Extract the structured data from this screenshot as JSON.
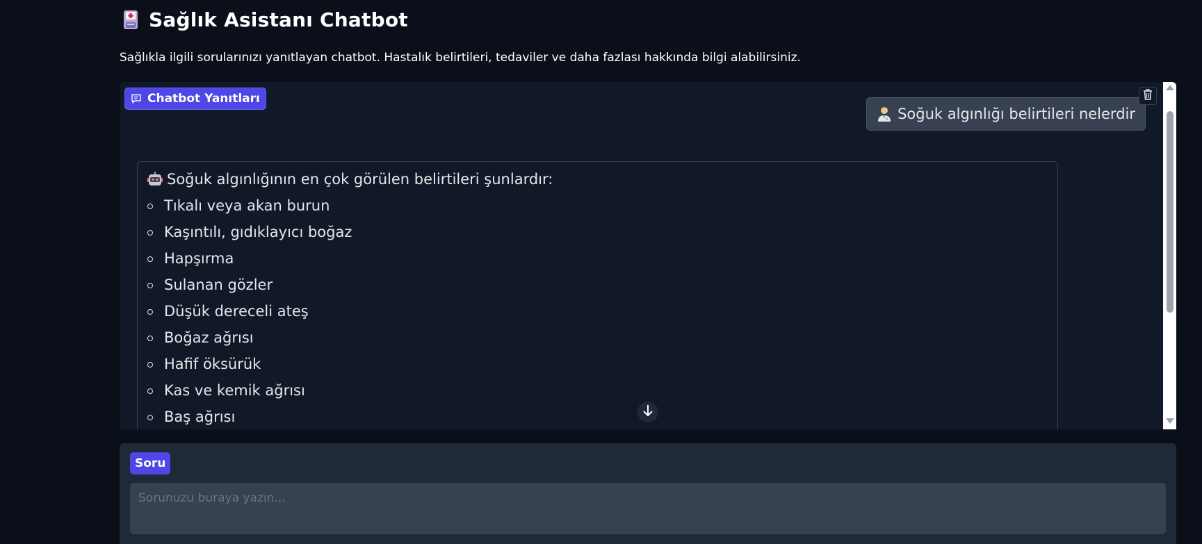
{
  "header": {
    "title": "Sağlık Asistanı Chatbot",
    "title_icon": "medical-disk-icon",
    "subtitle": "Sağlıkla ilgili sorularınızı yanıtlayan chatbot. Hastalık belirtileri, tedaviler ve daha fazlası hakkında bilgi alabilirsiniz."
  },
  "chat": {
    "label": "Chatbot Yanıtları",
    "label_icon": "chat-bubble-icon",
    "clear_icon": "trash-icon",
    "user_message": {
      "avatar": "doctor-icon",
      "text": "Soğuk algınlığı belirtileri nelerdir"
    },
    "bot_message": {
      "avatar": "robot-icon",
      "intro": "Soğuk algınlığının en çok görülen belirtileri şunlardır:",
      "items": [
        "Tıkalı veya akan burun",
        "Kaşıntılı, gıdıklayıcı boğaz",
        "Hapşırma",
        "Sulanan gözler",
        "Düşük dereceli ateş",
        "Boğaz ağrısı",
        "Hafif öksürük",
        "Kas ve kemik ağrısı",
        "Baş ağrısı"
      ]
    },
    "scroll_down_icon": "arrow-down-icon"
  },
  "input": {
    "label": "Soru",
    "value": "",
    "placeholder": "Sorunuzu buraya yazın..."
  },
  "colors": {
    "background": "#0b0f19",
    "panel": "#111827",
    "accent": "#4f46e5",
    "input_bg": "#374151"
  }
}
